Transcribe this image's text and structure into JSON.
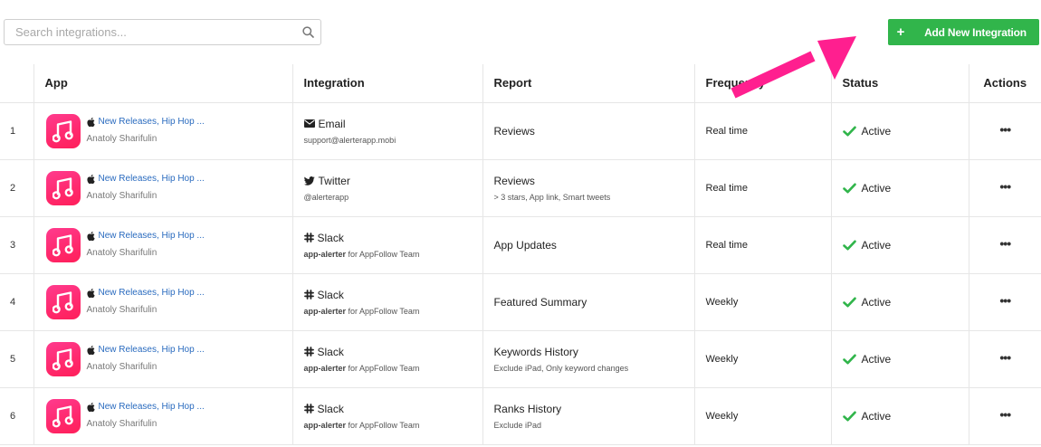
{
  "search": {
    "placeholder": "Search integrations..."
  },
  "toolbar": {
    "add_plus": "+",
    "add_label": "Add New Integration"
  },
  "columns": {
    "num": "",
    "app": "App",
    "integration": "Integration",
    "report": "Report",
    "frequency": "Frequency",
    "status": "Status",
    "actions": "Actions"
  },
  "colors": {
    "accent_green": "#31b54b",
    "link_blue": "#2a6bbf",
    "app_icon_pink": "#ff2a6f",
    "arrow_magenta": "#ff1f8f"
  },
  "rows": [
    {
      "num": "1",
      "app_name": "New Releases, Hip Hop ...",
      "app_author": "Anatoly Sharifulin",
      "integration": "Email",
      "integration_icon": "envelope-icon",
      "integration_sub_bold": "",
      "integration_sub": "support@alerterapp.mobi",
      "report": "Reviews",
      "report_sub": "",
      "frequency": "Real time",
      "status": "Active",
      "actions": "•••"
    },
    {
      "num": "2",
      "app_name": "New Releases, Hip Hop ...",
      "app_author": "Anatoly Sharifulin",
      "integration": "Twitter",
      "integration_icon": "twitter-icon",
      "integration_sub_bold": "",
      "integration_sub": "@alerterapp",
      "report": "Reviews",
      "report_sub": "> 3 stars, App link, Smart tweets",
      "frequency": "Real time",
      "status": "Active",
      "actions": "•••"
    },
    {
      "num": "3",
      "app_name": "New Releases, Hip Hop ...",
      "app_author": "Anatoly Sharifulin",
      "integration": "Slack",
      "integration_icon": "slack-icon",
      "integration_sub_bold": "app-alerter",
      "integration_sub": " for AppFollow Team",
      "report": "App Updates",
      "report_sub": "",
      "frequency": "Real time",
      "status": "Active",
      "actions": "•••"
    },
    {
      "num": "4",
      "app_name": "New Releases, Hip Hop ...",
      "app_author": "Anatoly Sharifulin",
      "integration": "Slack",
      "integration_icon": "slack-icon",
      "integration_sub_bold": "app-alerter",
      "integration_sub": " for AppFollow Team",
      "report": "Featured Summary",
      "report_sub": "",
      "frequency": "Weekly",
      "status": "Active",
      "actions": "•••"
    },
    {
      "num": "5",
      "app_name": "New Releases, Hip Hop ...",
      "app_author": "Anatoly Sharifulin",
      "integration": "Slack",
      "integration_icon": "slack-icon",
      "integration_sub_bold": "app-alerter",
      "integration_sub": " for AppFollow Team",
      "report": "Keywords History",
      "report_sub": "Exclude iPad, Only keyword changes",
      "frequency": "Weekly",
      "status": "Active",
      "actions": "•••"
    },
    {
      "num": "6",
      "app_name": "New Releases, Hip Hop ...",
      "app_author": "Anatoly Sharifulin",
      "integration": "Slack",
      "integration_icon": "slack-icon",
      "integration_sub_bold": "app-alerter",
      "integration_sub": " for AppFollow Team",
      "report": "Ranks History",
      "report_sub": "Exclude iPad",
      "frequency": "Weekly",
      "status": "Active",
      "actions": "•••"
    }
  ]
}
